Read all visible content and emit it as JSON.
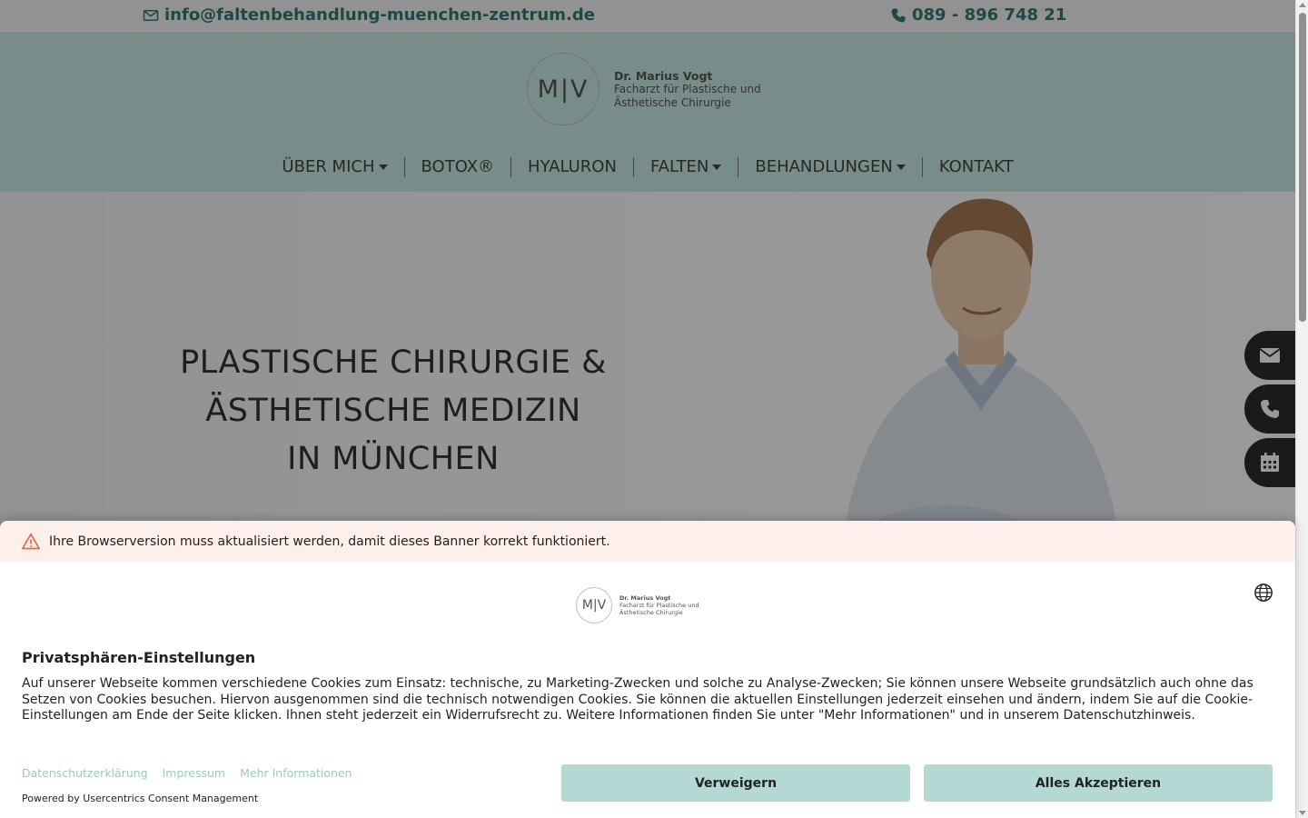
{
  "topbar": {
    "email": "info@faltenbehandlung-muenchen-zentrum.de",
    "phone": "089 - 896 748 21"
  },
  "logo": {
    "monogram": "M|V",
    "name": "Dr. Marius Vogt",
    "line1": "Facharzt für Plastische und",
    "line2": "Ästhetische Chirurgie"
  },
  "nav": {
    "items": [
      {
        "label": "ÜBER MICH"
      },
      {
        "label": "BOTOX®"
      },
      {
        "label": "HYALURON"
      },
      {
        "label": "FALTEN"
      },
      {
        "label": "BEHANDLUNGEN"
      },
      {
        "label": "KONTAKT"
      }
    ]
  },
  "hero": {
    "line1": "PLASTISCHE CHIRURGIE &",
    "line2": "ÄSTHETISCHE MEDIZIN",
    "line3": "IN MÜNCHEN"
  },
  "side_buttons": {
    "icons": [
      "envelope-icon",
      "phone-icon",
      "calendar-icon"
    ]
  },
  "consent": {
    "warning": "Ihre Browserversion muss aktualisiert werden, damit dieses Banner korrekt funktioniert.",
    "title": "Privatsphären-Einstellungen",
    "description": "Auf unserer Webseite kommen verschiedene Cookies zum Einsatz: technische, zu Marketing-Zwecken und solche zu Analyse-Zwecken; Sie können unsere Webseite grundsätzlich auch ohne das Setzen von Cookies besuchen. Hiervon ausgenommen sind die technisch notwendigen Cookies. Sie können die aktuellen Einstellungen jederzeit einsehen und ändern, indem Sie auf die Cookie-Einstellungen am Ende der Seite klicken. Ihnen steht jederzeit ein Widerrufsrecht zu. Weitere Informationen finden Sie unter \"Mehr Informationen\" und in unserem Datenschutzhinweis.",
    "links": [
      "Datenschutzerklärung",
      "Impressum",
      "Mehr Informationen"
    ],
    "powered_by": "Powered by Usercentrics Consent Management",
    "deny_label": "Verweigern",
    "accept_label": "Alles Akzeptieren"
  },
  "colors": {
    "brand_teal": "#2f7a76",
    "header_bg": "#c8eae6",
    "button_bg": "#b4d8d4",
    "link": "#9cc8c3",
    "warning_bg": "#fdf0eb"
  }
}
